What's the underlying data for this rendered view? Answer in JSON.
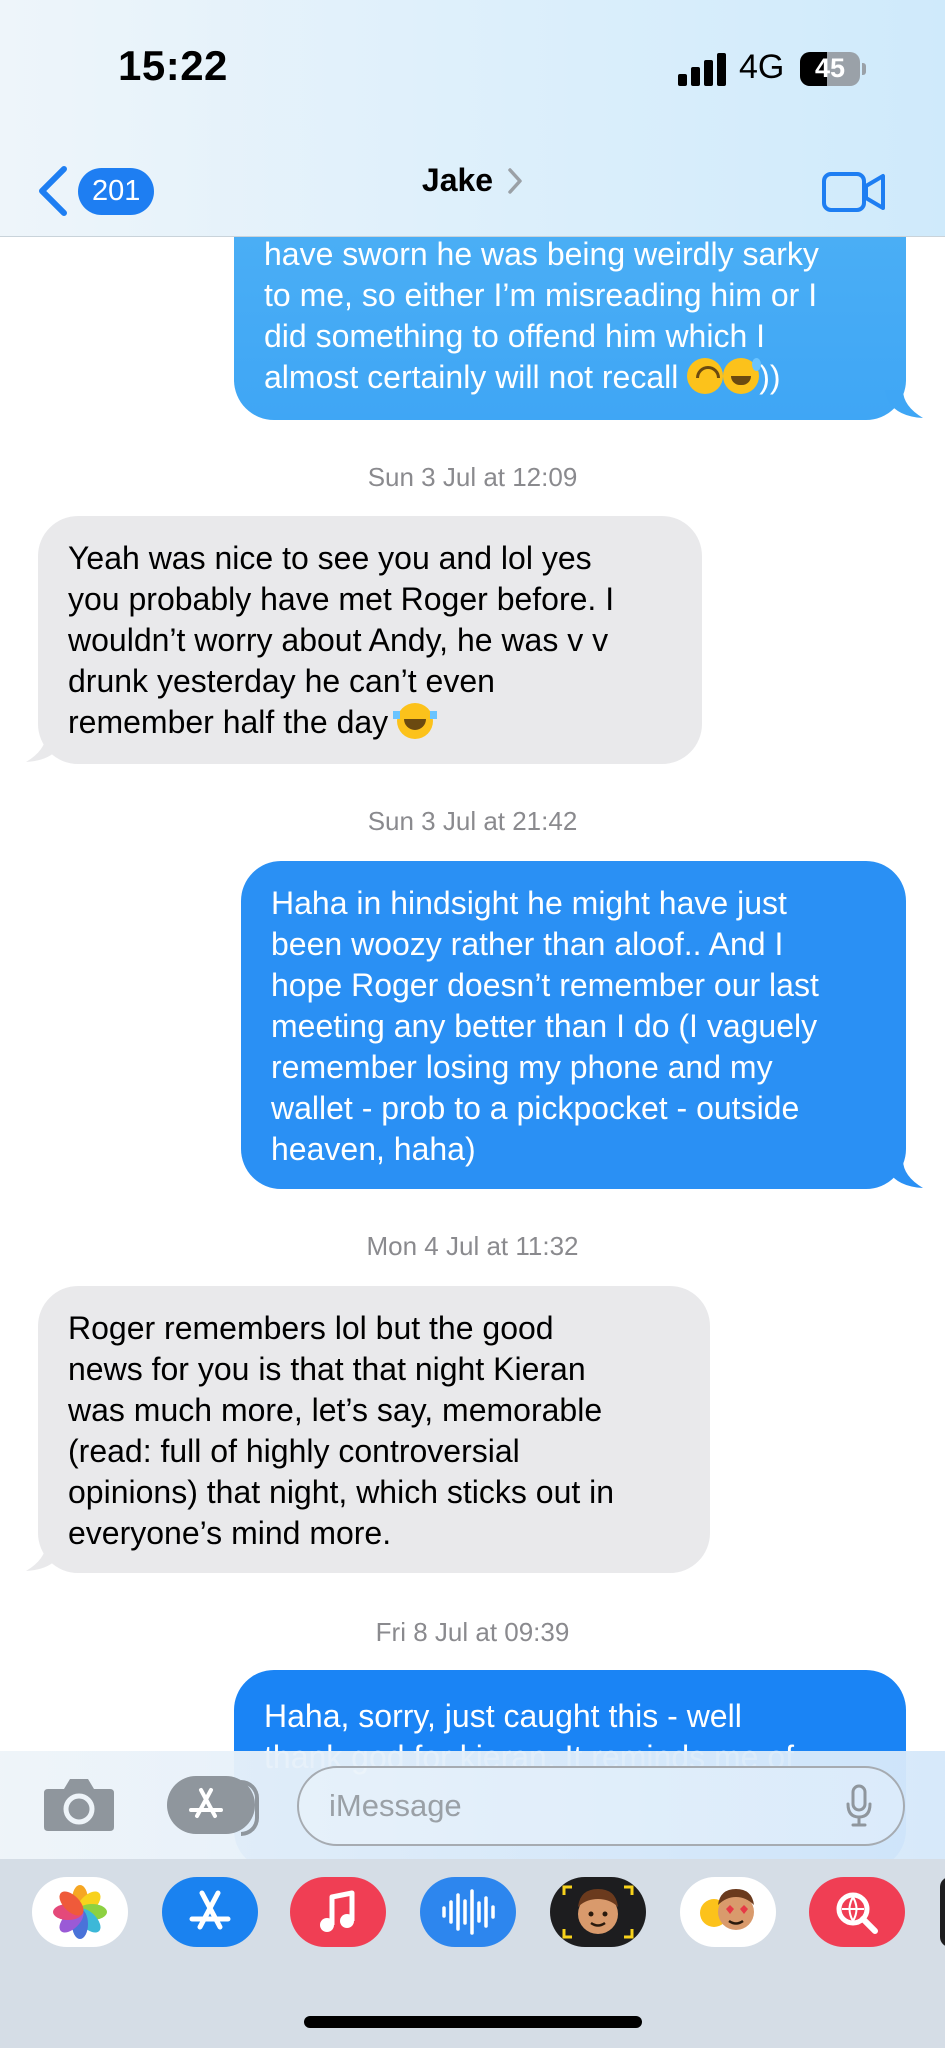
{
  "status_bar": {
    "time": "15:22",
    "network": "4G",
    "battery": "45",
    "battery_level": 0.45
  },
  "header": {
    "back_count": "201",
    "contact_name": "Jake",
    "video_icon": "video-camera-icon"
  },
  "messages": [
    {
      "direction": "outgoing",
      "lines": [
        "have sworn he was being weirdly sarky",
        "to me, so either I’m misreading him or I",
        "did something to offend him which I",
        "almost certainly will not recall"
      ],
      "emoji_tail": [
        "upside-down-face",
        "grinning-sweat"
      ],
      "tail_text": "))"
    },
    {
      "timestamp": "Sun 3 Jul at 12:09"
    },
    {
      "direction": "incoming",
      "lines": [
        "Yeah was nice to see you and lol yes",
        "you probably have met Roger before. I",
        "wouldn’t worry about Andy, he was v v",
        "drunk yesterday he can’t even",
        "remember half the day"
      ],
      "emoji_tail": [
        "face-with-tears-of-joy"
      ]
    },
    {
      "timestamp": "Sun 3 Jul at 21:42"
    },
    {
      "direction": "outgoing",
      "lines": [
        "Haha in hindsight he might have just",
        "been woozy rather than aloof.. And I",
        "hope Roger doesn’t remember our last",
        "meeting any better than I do (I vaguely",
        "remember losing my phone and my",
        "wallet - prob to a pickpocket - outside",
        "heaven, haha)"
      ]
    },
    {
      "timestamp": "Mon 4 Jul at 11:32"
    },
    {
      "direction": "incoming",
      "lines": [
        "Roger remembers lol but the good",
        "news for you is that that night Kieran",
        "was much more, let’s say, memorable",
        "(read: full of highly controversial",
        "opinions) that night, which sticks out in",
        "everyone’s mind more."
      ]
    },
    {
      "timestamp": "Fri 8 Jul at 09:39"
    },
    {
      "direction": "outgoing",
      "lines": [
        "Haha, sorry, just caught this - well",
        "thank god for kieran. It reminds me of"
      ]
    }
  ],
  "compose": {
    "placeholder": "iMessage",
    "camera_icon": "camera-icon",
    "apps_icon": "app-store-icon",
    "mic_icon": "microphone-icon"
  },
  "app_drawer": [
    "photos-icon",
    "app-store-icon",
    "music-icon",
    "audio-message-icon",
    "memoji-icon",
    "memoji-stickers-icon",
    "image-search-icon"
  ],
  "colors": {
    "incoming_bubble": "#e9e9eb",
    "outgoing_bubble": "#2a90f4",
    "accent": "#1e7ef2"
  }
}
